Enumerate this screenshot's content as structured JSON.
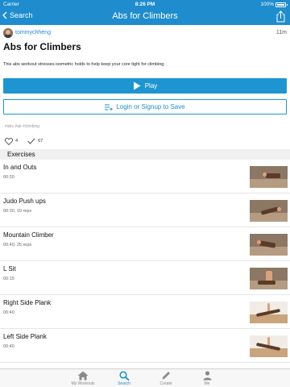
{
  "status_bar": {
    "carrier": "Carrier",
    "time": "8:26 PM",
    "battery": "100%"
  },
  "nav": {
    "back_label": "Search",
    "title": "Abs for Climbers",
    "share_icon": "share-icon"
  },
  "author": {
    "name": "tommychheng",
    "age": "11m"
  },
  "workout": {
    "title": "Abs for Climbers",
    "description": "This abs workout stresses isometric holds to help keep your core tight for climbing.",
    "hashtags": "#abs #ab #climbing"
  },
  "actions": {
    "play_label": "Play",
    "login_label": "Login or Signup to Save"
  },
  "stats": {
    "likes": "4",
    "completions": "67"
  },
  "exercises_header": "Exercises",
  "exercises": [
    {
      "name": "In and Outs",
      "detail": "00:30"
    },
    {
      "name": "Judo Push ups",
      "detail": "00:30, 10 reps"
    },
    {
      "name": "Mountain Climber",
      "detail": "00:40, 25 reps"
    },
    {
      "name": "L Sit",
      "detail": "00:15"
    },
    {
      "name": "Right Side Plank",
      "detail": "00:40"
    },
    {
      "name": "Left Side Plank",
      "detail": "00:40"
    }
  ],
  "tabs": [
    {
      "label": "My Workouts",
      "icon": "home-icon"
    },
    {
      "label": "Search",
      "icon": "search-icon"
    },
    {
      "label": "Create",
      "icon": "pencil-icon"
    },
    {
      "label": "Me",
      "icon": "person-icon"
    }
  ],
  "colors": {
    "brand": "#1e8ccd",
    "button": "#1e95d0",
    "section_bg": "#f0f0f0"
  }
}
